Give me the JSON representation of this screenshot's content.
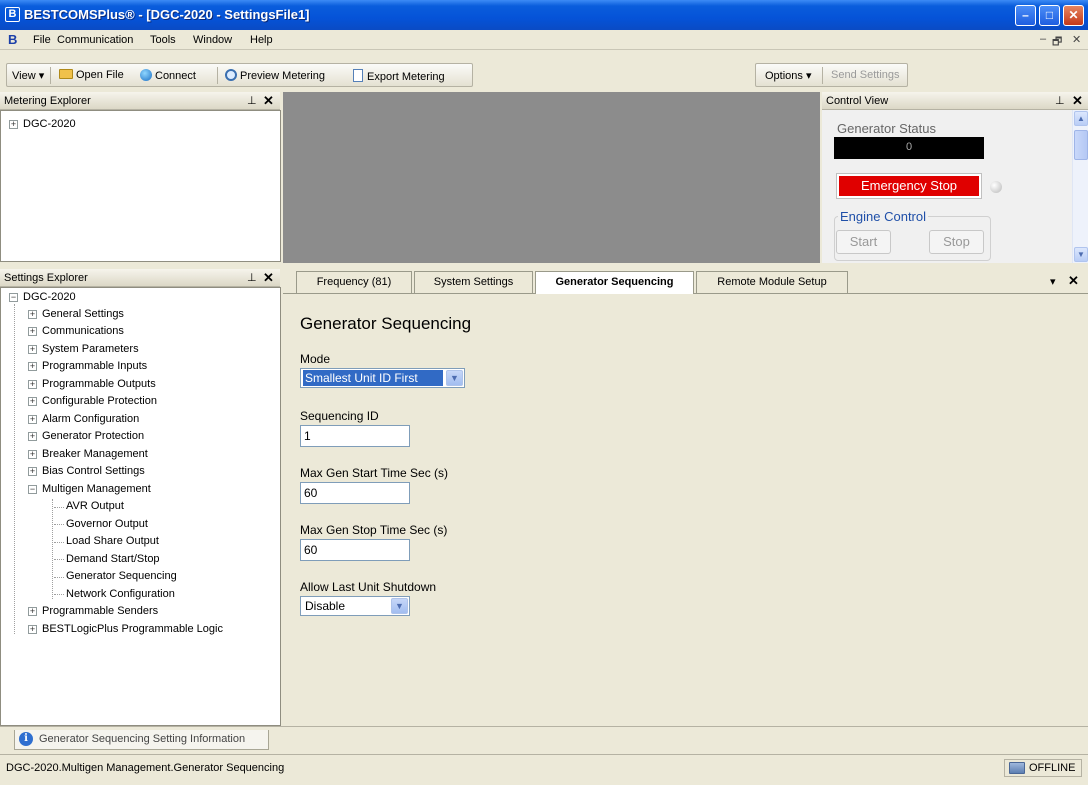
{
  "window": {
    "title": "BESTCOMSPlus® - [DGC-2020 - SettingsFile1]",
    "minimize": "–",
    "maximize": "□",
    "close": "✕"
  },
  "menu": {
    "items": [
      "File",
      "Communication",
      "Tools",
      "Window",
      "Help"
    ],
    "mdi_controls": [
      "–",
      "🗗",
      "✕"
    ]
  },
  "toolbar": {
    "view": "View ▾",
    "open_file": "Open File",
    "connect": "Connect",
    "preview_metering": "Preview Metering",
    "export_metering": "Export Metering",
    "options": "Options ▾",
    "send_settings": "Send Settings"
  },
  "metering_explorer": {
    "title": "Metering Explorer",
    "pin": "⊥",
    "close": "✕",
    "root": "DGC-2020"
  },
  "control_view": {
    "title": "Control View",
    "pin": "⊥",
    "close": "✕",
    "generator_status_label": "Generator Status",
    "generator_status_value": "0",
    "emergency_stop": "Emergency Stop",
    "engine_control_label": "Engine Control",
    "start": "Start",
    "stop": "Stop"
  },
  "settings_explorer": {
    "title": "Settings Explorer",
    "pin": "⊥",
    "close": "✕",
    "root": "DGC-2020",
    "items": [
      "General Settings",
      "Communications",
      "System Parameters",
      "Programmable Inputs",
      "Programmable Outputs",
      "Configurable Protection",
      "Alarm Configuration",
      "Generator Protection",
      "Breaker Management",
      "Bias Control Settings",
      "Multigen Management"
    ],
    "multigen_children": [
      "AVR Output",
      "Governor Output",
      "Load Share Output",
      "Demand Start/Stop",
      "Generator Sequencing",
      "Network Configuration"
    ],
    "after_items": [
      "Programmable Senders",
      "BESTLogicPlus Programmable Logic"
    ]
  },
  "tabs": {
    "items": [
      "Frequency (81)",
      "System Settings",
      "Generator Sequencing",
      "Remote Module Setup"
    ],
    "active_index": 2,
    "menu": "▾",
    "close": "✕"
  },
  "form": {
    "heading": "Generator Sequencing",
    "mode_label": "Mode",
    "mode_value": "Smallest Unit ID First",
    "sequencing_id_label": "Sequencing ID",
    "sequencing_id_value": "1",
    "max_start_label": "Max Gen Start Time Sec (s)",
    "max_start_value": "60",
    "max_stop_label": "Max Gen Stop Time Sec (s)",
    "max_stop_value": "60",
    "allow_shutdown_label": "Allow Last Unit Shutdown",
    "allow_shutdown_value": "Disable"
  },
  "info_tab": {
    "label": "Generator Sequencing Setting Information"
  },
  "status": {
    "path": "DGC-2020.Multigen Management.Generator Sequencing",
    "connection": "OFFLINE"
  },
  "colors": {
    "titlebar": "#0553d8",
    "emergency_stop": "#e00000",
    "metering_area": "#8c8c8c"
  }
}
